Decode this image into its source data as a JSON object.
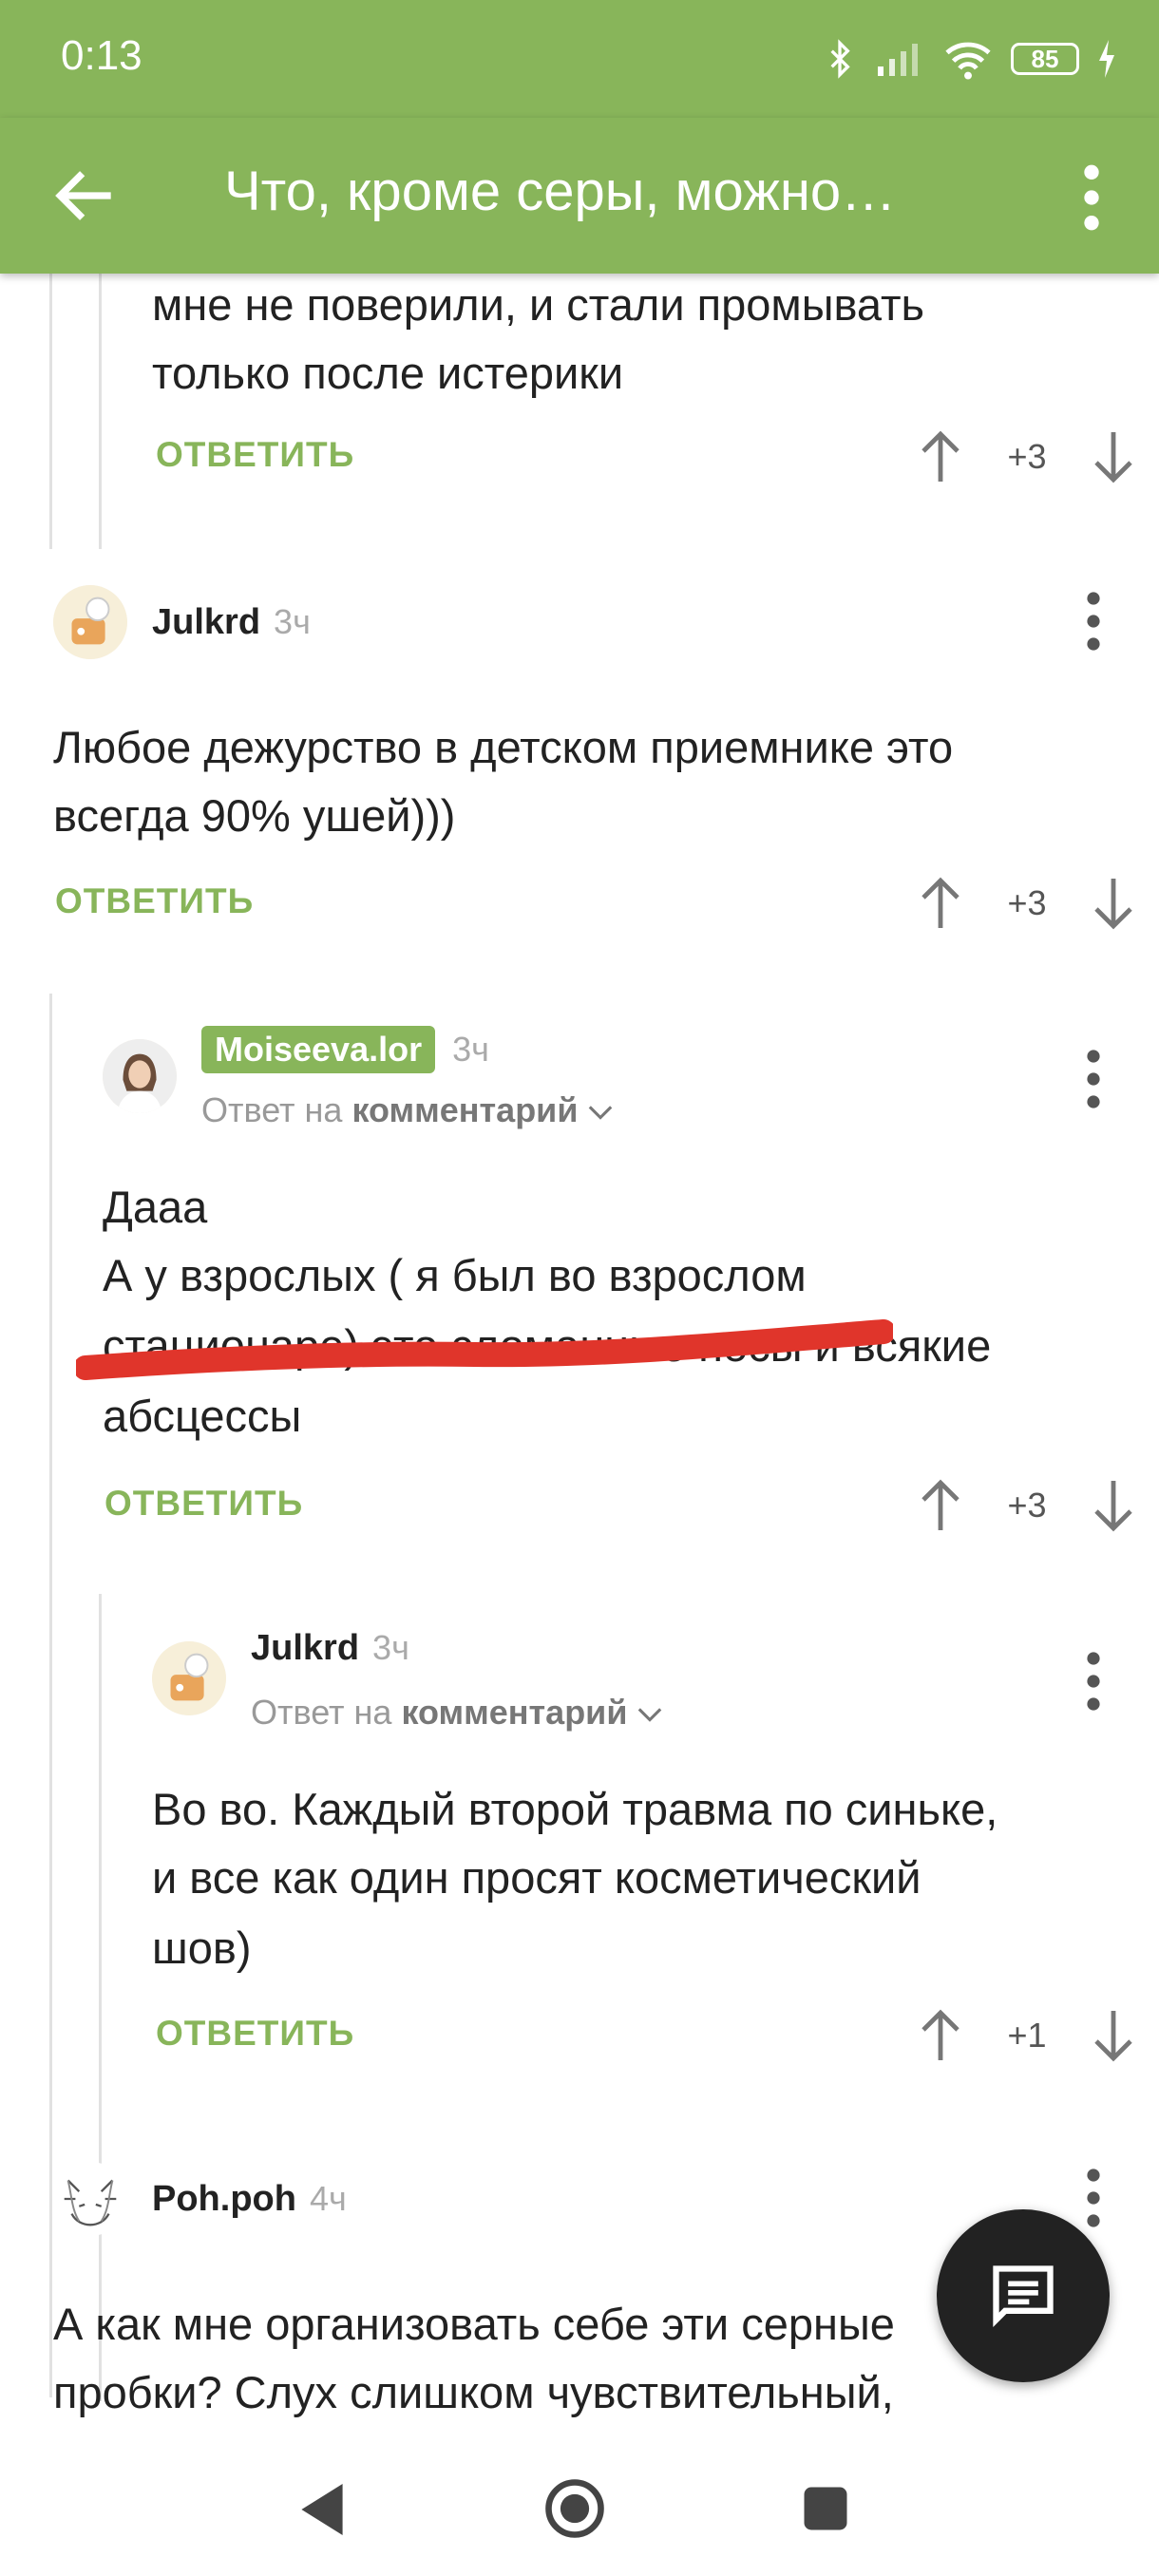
{
  "status": {
    "time": "0:13",
    "battery": "85"
  },
  "appbar": {
    "title": "Что, кроме серы, можно…"
  },
  "comments": [
    {
      "text": [
        "мне не поверили, и стали промывать",
        "только после истерики"
      ],
      "reply_label": "ОТВЕТИТЬ",
      "score": "+3"
    },
    {
      "author": "Julkrd",
      "time": "3ч",
      "text": [
        "Любое дежурство в детском приемнике это",
        "всегда 90% ушей)))"
      ],
      "reply_label": "ОТВЕТИТЬ",
      "score": "+3"
    },
    {
      "author": "Moiseeva.lor",
      "time": "3ч",
      "reply_to_prefix": "Ответ на",
      "reply_to_target": "комментарий",
      "text": [
        "Дааа",
        "А у взрослых ( я был во взрослом",
        "стационаре) это сломанные носы и всякие",
        "абсцессы"
      ],
      "reply_label": "ОТВЕТИТЬ",
      "score": "+3"
    },
    {
      "author": "Julkrd",
      "time": "3ч",
      "reply_to_prefix": "Ответ на",
      "reply_to_target": "комментарий",
      "text": [
        "Во во. Каждый второй травма по синьке,",
        "и все как один просят косметический",
        "шов)"
      ],
      "reply_label": "ОТВЕТИТЬ",
      "score": "+1"
    },
    {
      "author": "Poh.poh",
      "time": "4ч",
      "text": [
        "А как мне организовать себе эти серные",
        "пробки? Слух слишком чувствительный,"
      ]
    }
  ],
  "colors": {
    "accent": "#88b55a",
    "scribble": "#e0352b",
    "text": "#222222"
  },
  "icons": {
    "appbar": [
      "back-arrow-icon",
      "more-vert-icon"
    ],
    "vote": [
      "arrow-up-icon",
      "arrow-down-icon"
    ],
    "fab": "comment-icon",
    "nav": [
      "nav-back-icon",
      "nav-home-icon",
      "nav-recents-icon"
    ]
  }
}
